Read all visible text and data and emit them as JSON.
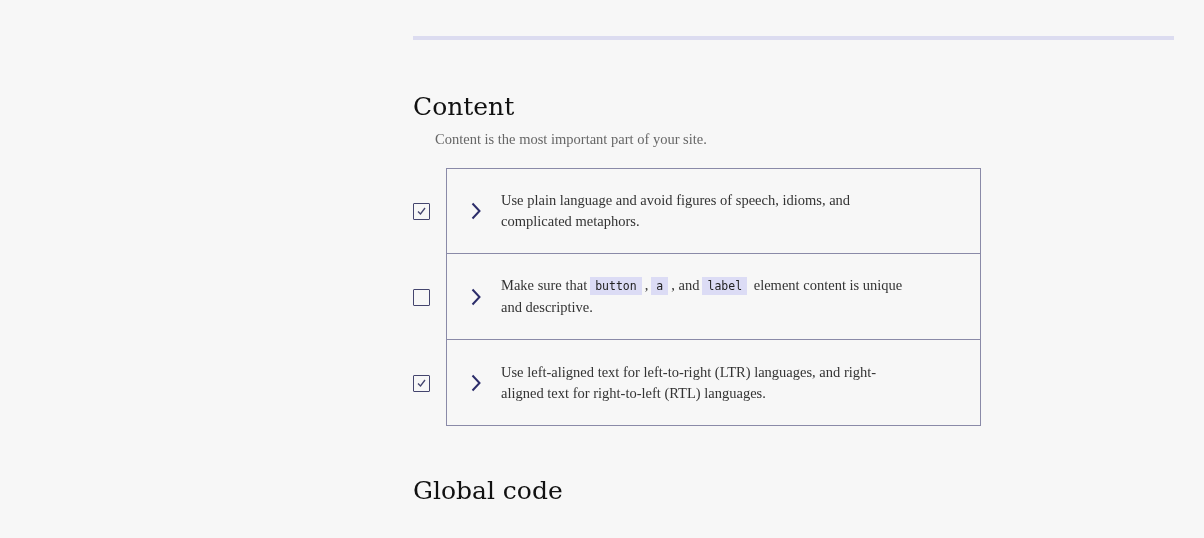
{
  "sections": [
    {
      "title": "Content",
      "description": "Content is the most important part of your site.",
      "items": [
        {
          "checked": true,
          "parts": [
            {
              "kind": "text",
              "text": "Use plain language and avoid figures of speech, idioms, and complicated metaphors."
            }
          ]
        },
        {
          "checked": false,
          "parts": [
            {
              "kind": "text",
              "text": "Make sure that"
            },
            {
              "kind": "code",
              "text": "button"
            },
            {
              "kind": "text",
              "text": ","
            },
            {
              "kind": "code",
              "text": "a"
            },
            {
              "kind": "text",
              "text": ", and"
            },
            {
              "kind": "code",
              "text": "label"
            },
            {
              "kind": "text",
              "text": "element content is unique and descriptive."
            }
          ]
        },
        {
          "checked": true,
          "parts": [
            {
              "kind": "text",
              "text": "Use left-aligned text for left-to-right (LTR) languages, and right-aligned text for right-to-left (RTL) languages."
            }
          ]
        }
      ]
    },
    {
      "title": "Global code"
    }
  ]
}
